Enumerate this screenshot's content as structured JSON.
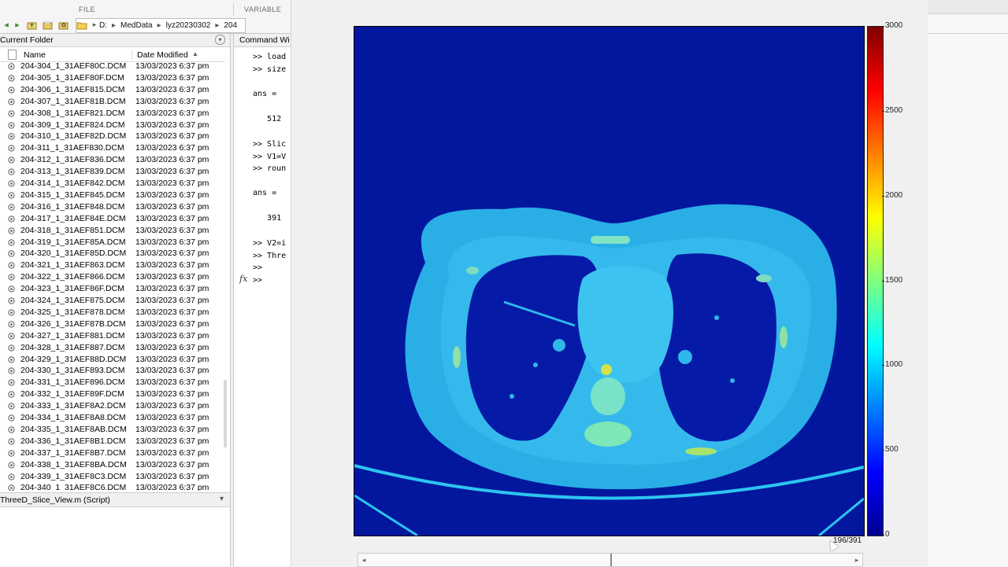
{
  "toolstrip": {
    "file_label": "FILE",
    "variable_label": "VARIABLE"
  },
  "address": {
    "path": [
      "D:",
      "MedData",
      "lyz20230302",
      "204"
    ]
  },
  "current_folder": {
    "title": "Current Folder",
    "columns": {
      "name": "Name",
      "date": "Date Modified"
    },
    "rows": [
      {
        "name": "204-304_1_31AEF80C.DCM",
        "date": "13/03/2023 6:37 pm"
      },
      {
        "name": "204-305_1_31AEF80F.DCM",
        "date": "13/03/2023 6:37 pm"
      },
      {
        "name": "204-306_1_31AEF815.DCM",
        "date": "13/03/2023 6:37 pm"
      },
      {
        "name": "204-307_1_31AEF81B.DCM",
        "date": "13/03/2023 6:37 pm"
      },
      {
        "name": "204-308_1_31AEF821.DCM",
        "date": "13/03/2023 6:37 pm"
      },
      {
        "name": "204-309_1_31AEF824.DCM",
        "date": "13/03/2023 6:37 pm"
      },
      {
        "name": "204-310_1_31AEF82D.DCM",
        "date": "13/03/2023 6:37 pm"
      },
      {
        "name": "204-311_1_31AEF830.DCM",
        "date": "13/03/2023 6:37 pm"
      },
      {
        "name": "204-312_1_31AEF836.DCM",
        "date": "13/03/2023 6:37 pm"
      },
      {
        "name": "204-313_1_31AEF839.DCM",
        "date": "13/03/2023 6:37 pm"
      },
      {
        "name": "204-314_1_31AEF842.DCM",
        "date": "13/03/2023 6:37 pm"
      },
      {
        "name": "204-315_1_31AEF845.DCM",
        "date": "13/03/2023 6:37 pm"
      },
      {
        "name": "204-316_1_31AEF848.DCM",
        "date": "13/03/2023 6:37 pm"
      },
      {
        "name": "204-317_1_31AEF84E.DCM",
        "date": "13/03/2023 6:37 pm"
      },
      {
        "name": "204-318_1_31AEF851.DCM",
        "date": "13/03/2023 6:37 pm"
      },
      {
        "name": "204-319_1_31AEF85A.DCM",
        "date": "13/03/2023 6:37 pm"
      },
      {
        "name": "204-320_1_31AEF85D.DCM",
        "date": "13/03/2023 6:37 pm"
      },
      {
        "name": "204-321_1_31AEF863.DCM",
        "date": "13/03/2023 6:37 pm"
      },
      {
        "name": "204-322_1_31AEF866.DCM",
        "date": "13/03/2023 6:37 pm"
      },
      {
        "name": "204-323_1_31AEF86F.DCM",
        "date": "13/03/2023 6:37 pm"
      },
      {
        "name": "204-324_1_31AEF875.DCM",
        "date": "13/03/2023 6:37 pm"
      },
      {
        "name": "204-325_1_31AEF878.DCM",
        "date": "13/03/2023 6:37 pm"
      },
      {
        "name": "204-326_1_31AEF87B.DCM",
        "date": "13/03/2023 6:37 pm"
      },
      {
        "name": "204-327_1_31AEF881.DCM",
        "date": "13/03/2023 6:37 pm"
      },
      {
        "name": "204-328_1_31AEF887.DCM",
        "date": "13/03/2023 6:37 pm"
      },
      {
        "name": "204-329_1_31AEF88D.DCM",
        "date": "13/03/2023 6:37 pm"
      },
      {
        "name": "204-330_1_31AEF893.DCM",
        "date": "13/03/2023 6:37 pm"
      },
      {
        "name": "204-331_1_31AEF896.DCM",
        "date": "13/03/2023 6:37 pm"
      },
      {
        "name": "204-332_1_31AEF89F.DCM",
        "date": "13/03/2023 6:37 pm"
      },
      {
        "name": "204-333_1_31AEF8A2.DCM",
        "date": "13/03/2023 6:37 pm"
      },
      {
        "name": "204-334_1_31AEF8A8.DCM",
        "date": "13/03/2023 6:37 pm"
      },
      {
        "name": "204-335_1_31AEF8AB.DCM",
        "date": "13/03/2023 6:37 pm"
      },
      {
        "name": "204-336_1_31AEF8B1.DCM",
        "date": "13/03/2023 6:37 pm"
      },
      {
        "name": "204-337_1_31AEF8B7.DCM",
        "date": "13/03/2023 6:37 pm"
      },
      {
        "name": "204-338_1_31AEF8BA.DCM",
        "date": "13/03/2023 6:37 pm"
      },
      {
        "name": "204-339_1_31AEF8C3.DCM",
        "date": "13/03/2023 6:37 pm"
      },
      {
        "name": "204-340_1_31AEF8C6.DCM",
        "date": "13/03/2023 6:37 pm"
      }
    ],
    "details_label": "ThreeD_Slice_View.m  (Script)"
  },
  "command_window": {
    "title": "Command Wi",
    "lines": [
      ">> load",
      ">> size",
      "",
      "ans =",
      "",
      "   512",
      "",
      ">> Slic",
      ">> V1=V",
      ">> roun",
      "",
      "ans =",
      "",
      "   391",
      "",
      ">> V2=i",
      ">> Thre",
      ">>",
      ">>"
    ],
    "fx_label": "fx"
  },
  "figure": {
    "colorbar_ticks": [
      "3000",
      "2500",
      "2000",
      "1500",
      "1000",
      "500",
      "0"
    ],
    "colorbar_range": [
      0,
      3000
    ],
    "slice_indicator": "196/391",
    "slider_value": 196,
    "slider_max": 391
  },
  "colors": {
    "background": "#03179e",
    "body": "#29aee6",
    "lung": "#061aa8",
    "bone": "#9ee07a"
  }
}
